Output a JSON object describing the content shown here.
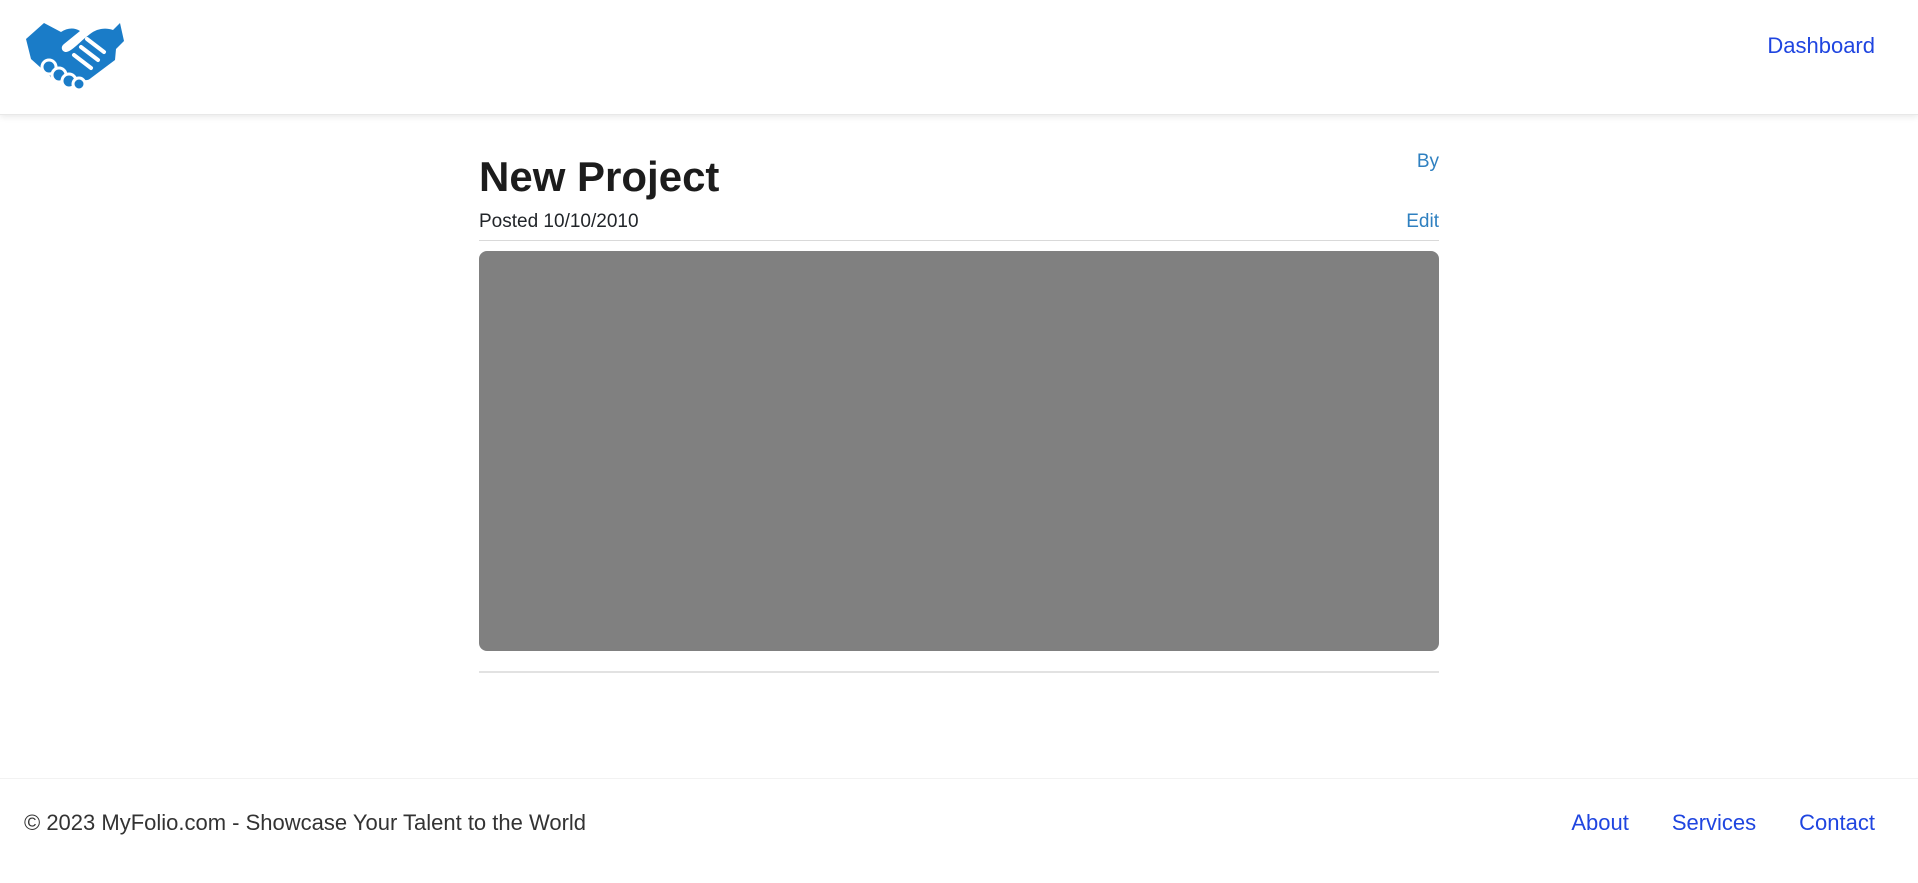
{
  "header": {
    "logo_icon": "handshake-icon",
    "logo_color": "#1a7cc8",
    "dashboard_label": "Dashboard"
  },
  "project": {
    "title": "New Project",
    "by_label": "By",
    "posted": "Posted 10/10/2010",
    "edit_label": "Edit",
    "media_color": "#808080"
  },
  "footer": {
    "copyright": "© 2023 MyFolio.com - Showcase Your Talent to the World",
    "links": [
      {
        "label": "About"
      },
      {
        "label": "Services"
      },
      {
        "label": "Contact"
      }
    ]
  },
  "colors": {
    "link": "#1f45e0",
    "secondary_link": "#2f80c0"
  }
}
